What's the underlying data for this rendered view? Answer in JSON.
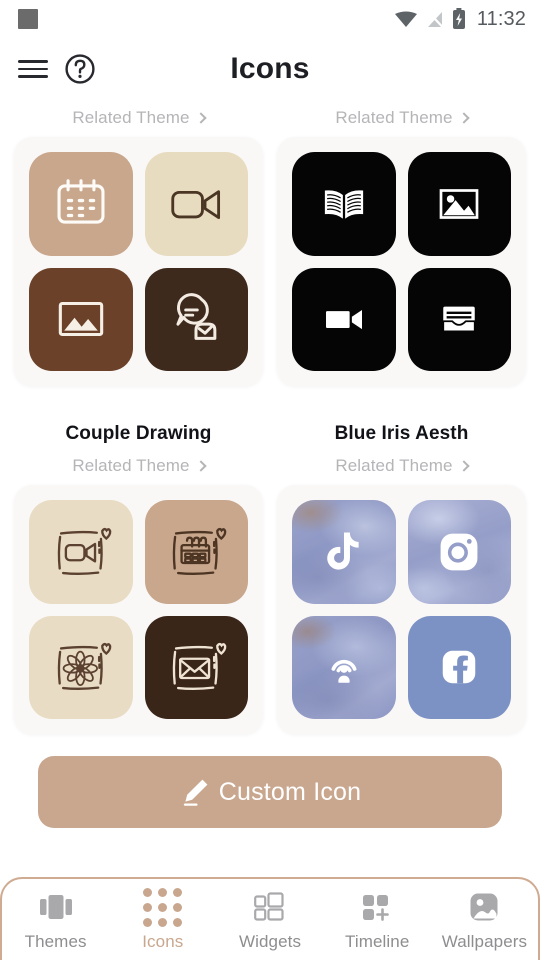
{
  "status_bar": {
    "app_indicator": "app-square-icon",
    "wifi_icon": "wifi-icon",
    "signal_icon": "signal-off-icon",
    "battery_icon": "battery-charging-icon",
    "time": "11:32"
  },
  "header": {
    "menu_icon": "hamburger-menu-icon",
    "help_icon": "help-circle-icon",
    "title": "Icons"
  },
  "themes": [
    {
      "name": "",
      "related_label": "Related Theme",
      "card_bg": "#faf8f7",
      "tiles": [
        {
          "icon": "calendar-icon",
          "bg": "#c9a78c",
          "fg": "#fdfbf7"
        },
        {
          "icon": "video-camera-icon",
          "bg": "#e8dcc0",
          "fg": "#4b3524"
        },
        {
          "icon": "image-icon",
          "bg": "#6b4229",
          "fg": "#f6efe6"
        },
        {
          "icon": "chat-person-icon",
          "bg": "#3d2a1d",
          "fg": "#f4ece2"
        }
      ]
    },
    {
      "name": "",
      "related_label": "Related Theme",
      "card_bg": "#faf8f7",
      "tiles": [
        {
          "icon": "open-book-icon",
          "bg": "#050505",
          "fg": "#ffffff"
        },
        {
          "icon": "photo-icon",
          "bg": "#050505",
          "fg": "#ffffff"
        },
        {
          "icon": "video-camera-icon",
          "bg": "#050505",
          "fg": "#ffffff"
        },
        {
          "icon": "wallet-icon",
          "bg": "#050505",
          "fg": "#ffffff"
        }
      ]
    },
    {
      "name": "Couple Drawing",
      "related_label": "Related Theme",
      "card_bg": "#faf8f7",
      "tiles": [
        {
          "icon": "video-camera-sketch-icon",
          "bg": "#e9dcc4",
          "fg": "#5b4130"
        },
        {
          "icon": "calendar-sketch-icon",
          "bg": "#c8a78d",
          "fg": "#4d3523"
        },
        {
          "icon": "flower-sketch-icon",
          "bg": "#e9dcc4",
          "fg": "#5b4130"
        },
        {
          "icon": "envelope-sketch-icon",
          "bg": "#3a2519",
          "fg": "#efe4d4"
        }
      ]
    },
    {
      "name": "Blue Iris Aesth",
      "related_label": "Related Theme",
      "card_bg": "#faf8f7",
      "tiles": [
        {
          "icon": "tiktok-icon",
          "bg": "#8e98c4",
          "fg": "#ffffff"
        },
        {
          "icon": "instagram-icon",
          "bg": "#959ec8",
          "fg": "#ffffff"
        },
        {
          "icon": "podcast-icon",
          "bg": "#8d97c3",
          "fg": "#ffffff"
        },
        {
          "icon": "facebook-icon",
          "bg": "#7d92c4",
          "fg": "#ffffff"
        }
      ]
    }
  ],
  "custom_icon_button": {
    "label": "Custom Icon",
    "icon": "pencil-edit-icon",
    "color": "#c9a78f"
  },
  "bottom_nav": {
    "active": "Icons",
    "accent_color": "#c9a78f",
    "inactive_color": "#a9a9ac",
    "items": [
      {
        "label": "Themes",
        "icon": "themes-cards-icon"
      },
      {
        "label": "Icons",
        "icon": "icons-dot-grid-icon"
      },
      {
        "label": "Widgets",
        "icon": "widgets-squares-icon"
      },
      {
        "label": "Timeline",
        "icon": "timeline-plus-icon"
      },
      {
        "label": "Wallpapers",
        "icon": "wallpapers-image-icon"
      }
    ]
  }
}
